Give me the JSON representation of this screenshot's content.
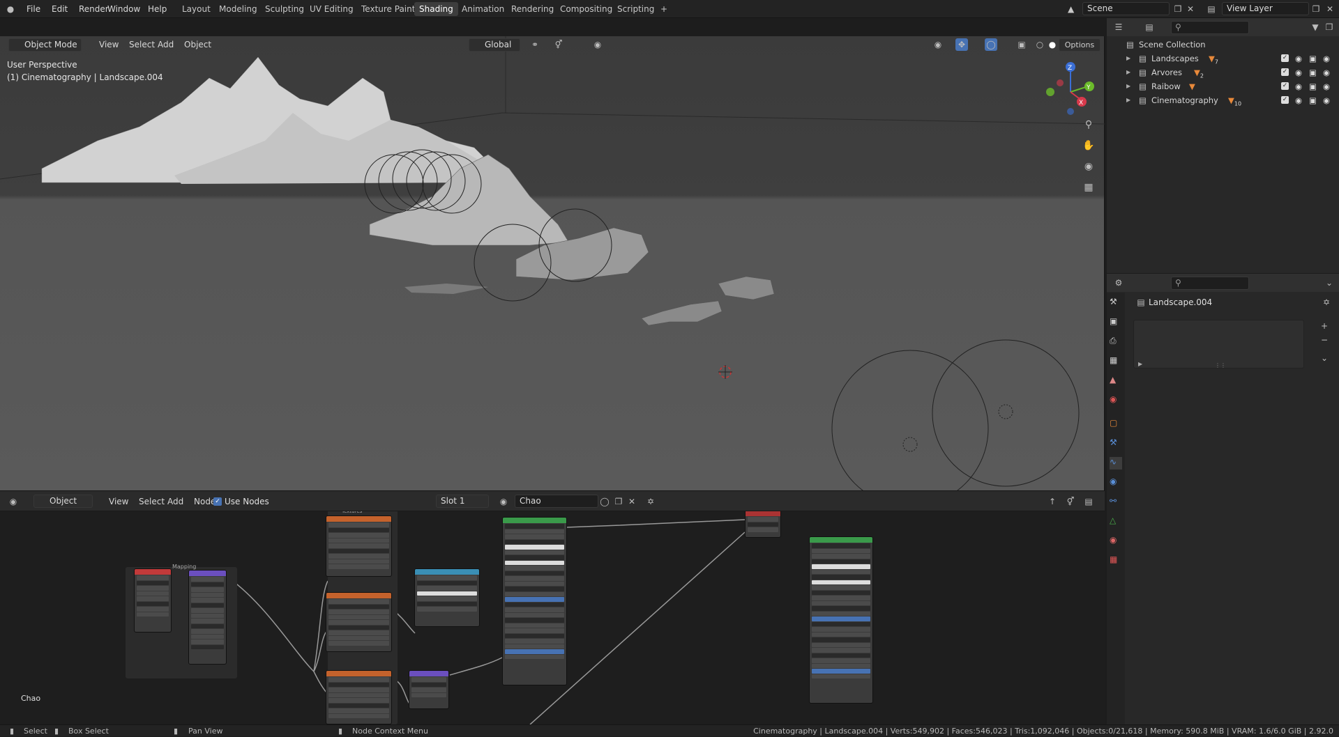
{
  "topbar": {
    "menus": [
      "File",
      "Edit",
      "Render",
      "Window",
      "Help"
    ],
    "workspaces": [
      "Layout",
      "Modeling",
      "Sculpting",
      "UV Editing",
      "Texture Paint",
      "Shading",
      "Animation",
      "Rendering",
      "Compositing",
      "Scripting"
    ],
    "active_workspace": "Shading",
    "add_workspace": "+",
    "scene": "Scene",
    "view_layer": "View Layer"
  },
  "viewport": {
    "mode": "Object Mode",
    "menus": [
      "View",
      "Select",
      "Add",
      "Object"
    ],
    "transform_orientation": "Global",
    "options": "Options",
    "overlay_text_1": "User Perspective",
    "overlay_text_2": "(1) Cinematography | Landscape.004",
    "gizmo_axes": [
      "Z",
      "Y",
      "X"
    ]
  },
  "outliner": {
    "root": "Scene Collection",
    "items": [
      {
        "label": "Landscapes",
        "badge": "7"
      },
      {
        "label": "Arvores",
        "badge": "2"
      },
      {
        "label": "Raibow",
        "badge": ""
      },
      {
        "label": "Cinematography",
        "badge": "10"
      }
    ]
  },
  "properties": {
    "object_name": "Landscape.004"
  },
  "node_editor": {
    "type": "Object",
    "menus": [
      "View",
      "Select",
      "Add",
      "Node"
    ],
    "use_nodes_label": "Use Nodes",
    "use_nodes": true,
    "slot": "Slot 1",
    "material": "Chao",
    "frame_labels": {
      "mapping": "Mapping",
      "textures": "Textures"
    },
    "corner_label": "Chao"
  },
  "statusbar": {
    "select": "Select",
    "box_select": "Box Select",
    "pan_view": "Pan View",
    "context_menu": "Node Context Menu",
    "stats": "Cinematography | Landscape.004 | Verts:549,902 | Faces:546,023 | Tris:1,092,046 | Objects:0/21,618 | Memory: 590.8 MiB | VRAM: 1.6/6.0 GiB | 2.92.0"
  },
  "colors": {
    "accent": "#4772b3",
    "active_ws": "#3d3d3d",
    "bg": "#1d1d1d"
  }
}
